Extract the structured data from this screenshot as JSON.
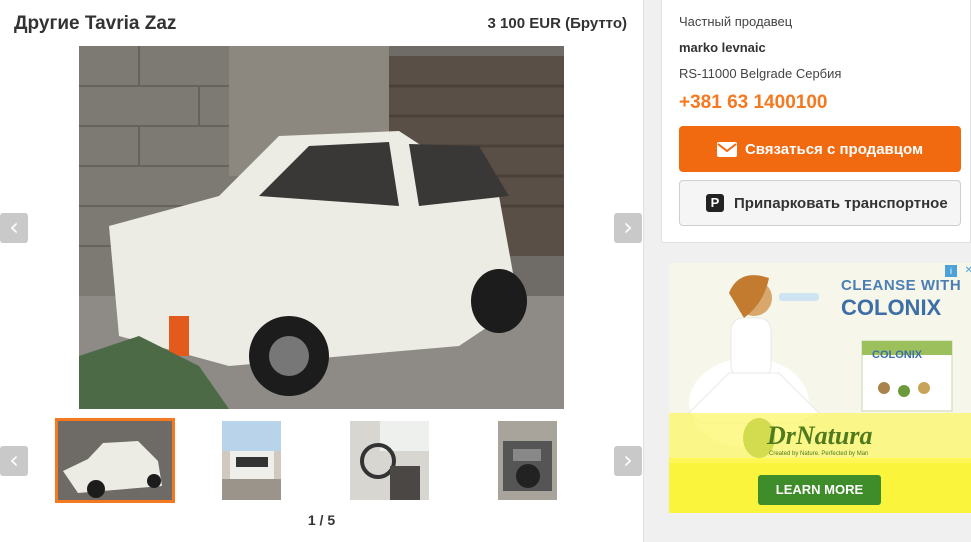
{
  "listing": {
    "title": "Другие Tavria Zaz",
    "price": "3 100 EUR (Брутто)"
  },
  "gallery": {
    "counter": "1 / 5",
    "prev_icon": "‹",
    "next_icon": "›",
    "thumbnails": [
      "photo-1",
      "photo-2",
      "photo-3",
      "photo-4"
    ]
  },
  "seller": {
    "type": "Частный продавец",
    "name": "marko levnaic",
    "address": "RS-11000 Belgrade Сербия",
    "phone": "+381 63 1400100",
    "contact_label": "Связаться с продавцом",
    "park_label": "Припарковать транспортное",
    "park_icon": "P"
  },
  "ad": {
    "headline_1": "CLEANSE WITH",
    "headline_2": "COLONIX",
    "box_label": "COLONIX",
    "brand": "DrNatura",
    "tagline": "Created by Nature. Perfected by Man",
    "cta": "LEARN MORE",
    "choices_icon": "i",
    "close_icon": "✕"
  },
  "colors": {
    "accent": "#f26a10",
    "phone": "#f47920",
    "ad_green": "#3f8c2a"
  }
}
